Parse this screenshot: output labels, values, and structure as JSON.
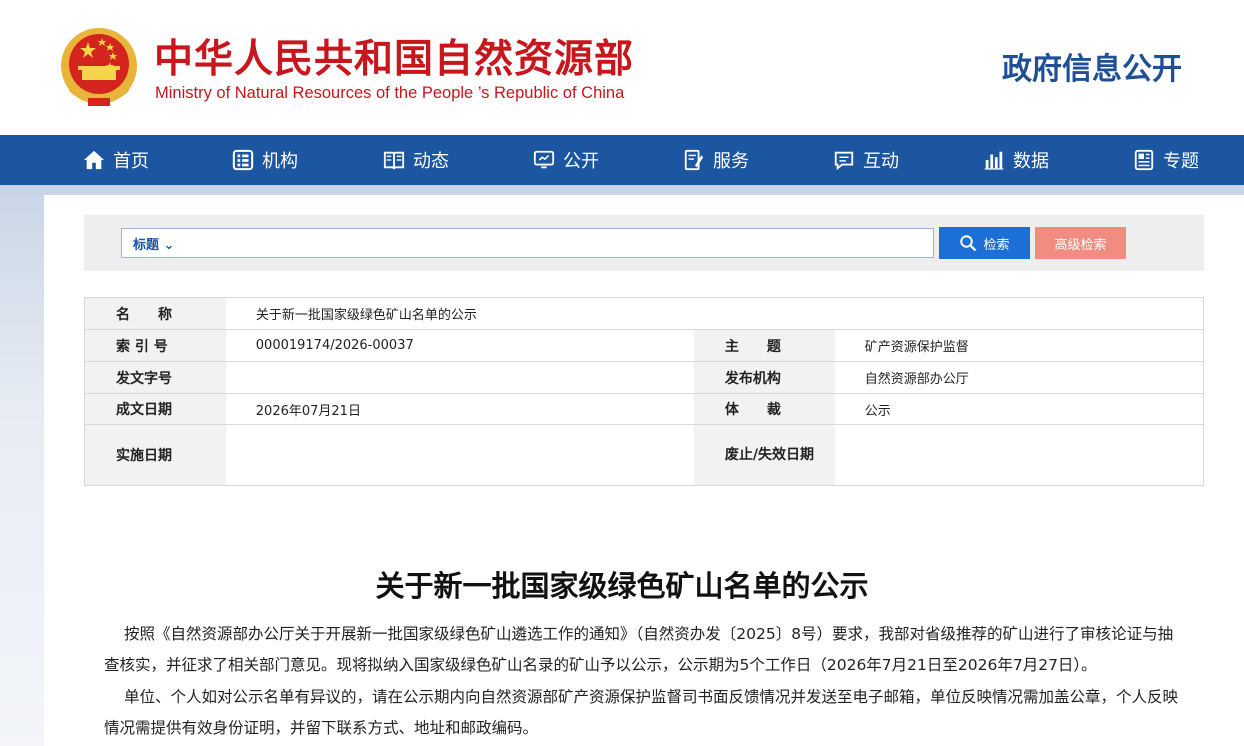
{
  "header": {
    "title_cn": "中华人民共和国自然资源部",
    "title_en": "Ministry of Natural Resources of the People ’s Republic of China",
    "gov_info": "政府信息公开",
    "colors": {
      "brand_red": "#c8161d",
      "brand_blue": "#1f4f95"
    }
  },
  "nav": {
    "items": [
      {
        "label": "首页",
        "icon": "home-icon"
      },
      {
        "label": "机构",
        "icon": "organization-icon"
      },
      {
        "label": "动态",
        "icon": "book-icon"
      },
      {
        "label": "公开",
        "icon": "monitor-icon"
      },
      {
        "label": "服务",
        "icon": "document-edit-icon"
      },
      {
        "label": "互动",
        "icon": "chat-icon"
      },
      {
        "label": "数据",
        "icon": "bar-chart-icon"
      },
      {
        "label": "专题",
        "icon": "topic-icon"
      }
    ],
    "color": "#1c55a0"
  },
  "search": {
    "select_label": "标题",
    "value": "",
    "search_button": "检索",
    "advanced_button": "高级检索",
    "colors": {
      "search": "#1c6fd6",
      "advanced": "#f28c80"
    }
  },
  "info_table": {
    "name_label": "名　　称",
    "name_value": "关于新一批国家级绿色矿山名单的公示",
    "index_label": "索 引 号",
    "index_value": "000019174/2026-00037",
    "topic_label": "主　　题",
    "topic_value": "矿产资源保护监督",
    "doc_no_label": "发文字号",
    "doc_no_value": "",
    "publisher_label": "发布机构",
    "publisher_value": "自然资源部办公厅",
    "date_label": "成文日期",
    "date_value": "2026年07月21日",
    "genre_label": "体　　裁",
    "genre_value": "公示",
    "effective_label": "实施日期",
    "effective_value": "",
    "expiry_label": "废止/失效日期",
    "expiry_value": ""
  },
  "article": {
    "title": "关于新一批国家级绿色矿山名单的公示",
    "paragraphs": [
      "按照《自然资源部办公厅关于开展新一批国家级绿色矿山遴选工作的通知》（自然资办发〔2025〕8号）要求，我部对省级推荐的矿山进行了审核论证与抽查核实，并征求了相关部门意见。现将拟纳入国家级绿色矿山名录的矿山予以公示，公示期为5个工作日（2026年7月21日至2026年7月27日）。",
      "单位、个人如对公示名单有异议的，请在公示期内向自然资源部矿产资源保护监督司书面反馈情况并发送至电子邮箱，单位反映情况需加盖公章，个人反映情况需提供有效身份证明，并留下联系方式、地址和邮政编码。"
    ]
  }
}
